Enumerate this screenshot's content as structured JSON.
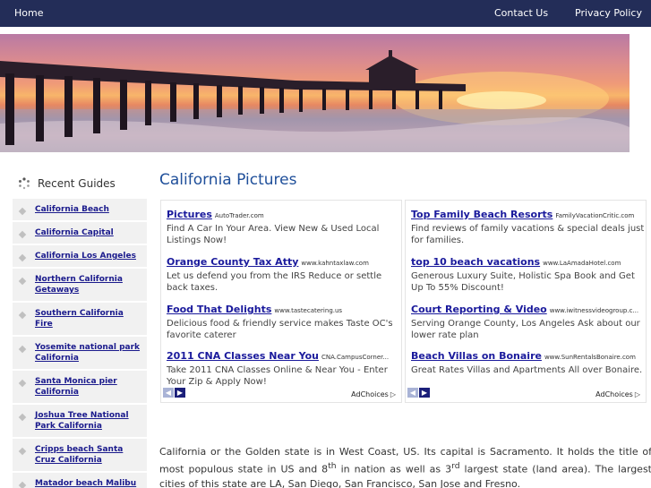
{
  "nav": {
    "home": "Home",
    "contact": "Contact Us",
    "privacy": "Privacy Policy"
  },
  "sidebar": {
    "title": "Recent Guides",
    "items": [
      {
        "label": "California Beach"
      },
      {
        "label": "California Capital"
      },
      {
        "label": "California Los Angeles"
      },
      {
        "label": "Northern California Getaways"
      },
      {
        "label": "Southern California Fire"
      },
      {
        "label": "Yosemite national park California"
      },
      {
        "label": "Santa Monica pier California"
      },
      {
        "label": "Joshua Tree National Park California"
      },
      {
        "label": "Cripps beach Santa Cruz California"
      },
      {
        "label": "Matador beach Malibu California"
      }
    ]
  },
  "main": {
    "title": "California Pictures",
    "paragraph_part1": "California or the Golden state is in West Coast, US. Its capital is Sacramento. It holds the title of most populous state in US and 8",
    "sup1": "th",
    "paragraph_part2": " in nation as well as 3",
    "sup2": "rd",
    "paragraph_part3": " largest state (land area). The largest cities of this state are LA, San Diego, San Francisco, San Jose and Fresno."
  },
  "ads": {
    "adchoices": "AdChoices",
    "left": [
      {
        "title": "Pictures",
        "domain": "AutoTrader.com",
        "text": "Find A Car In Your Area. View New & Used Local Listings Now!"
      },
      {
        "title": "Orange County Tax Atty",
        "domain": "www.kahntaxlaw.com",
        "text": "Let us defend you from the IRS Reduce or settle back taxes."
      },
      {
        "title": "Food That Delights",
        "domain": "www.tastecatering.us",
        "text": "Delicious food & friendly service makes Taste OC's favorite caterer"
      },
      {
        "title": "2011 CNA Classes Near You",
        "domain": "CNA.CampusCorner...",
        "text": "Take 2011 CNA Classes Online & Near You - Enter Your Zip & Apply Now!"
      }
    ],
    "right": [
      {
        "title": "Top Family Beach Resorts",
        "domain": "FamilyVacationCritic.com",
        "text": "Find reviews of family vacations & special deals just for families."
      },
      {
        "title": "top 10 beach vacations",
        "domain": "www.LaAmadaHotel.com",
        "text": "Generous Luxury Suite, Holistic Spa Book and Get Up To 55% Discount!"
      },
      {
        "title": "Court Reporting & Video",
        "domain": "www.iwitnessvideogroup.c...",
        "text": "Serving Orange County, Los Angeles Ask about our lower rate plan"
      },
      {
        "title": "Beach Villas on Bonaire",
        "domain": "www.SunRentalsBonaire.com",
        "text": "Great Rates Villas and Apartments All over Bonaire."
      }
    ]
  },
  "icons": {
    "sidebar_title_icon": "spinner-icon",
    "sidebar_bullet": "diamond-bullet-icon",
    "prev": "chevron-left-icon",
    "next": "chevron-right-icon",
    "adchoices": "adchoices-triangle-icon"
  }
}
